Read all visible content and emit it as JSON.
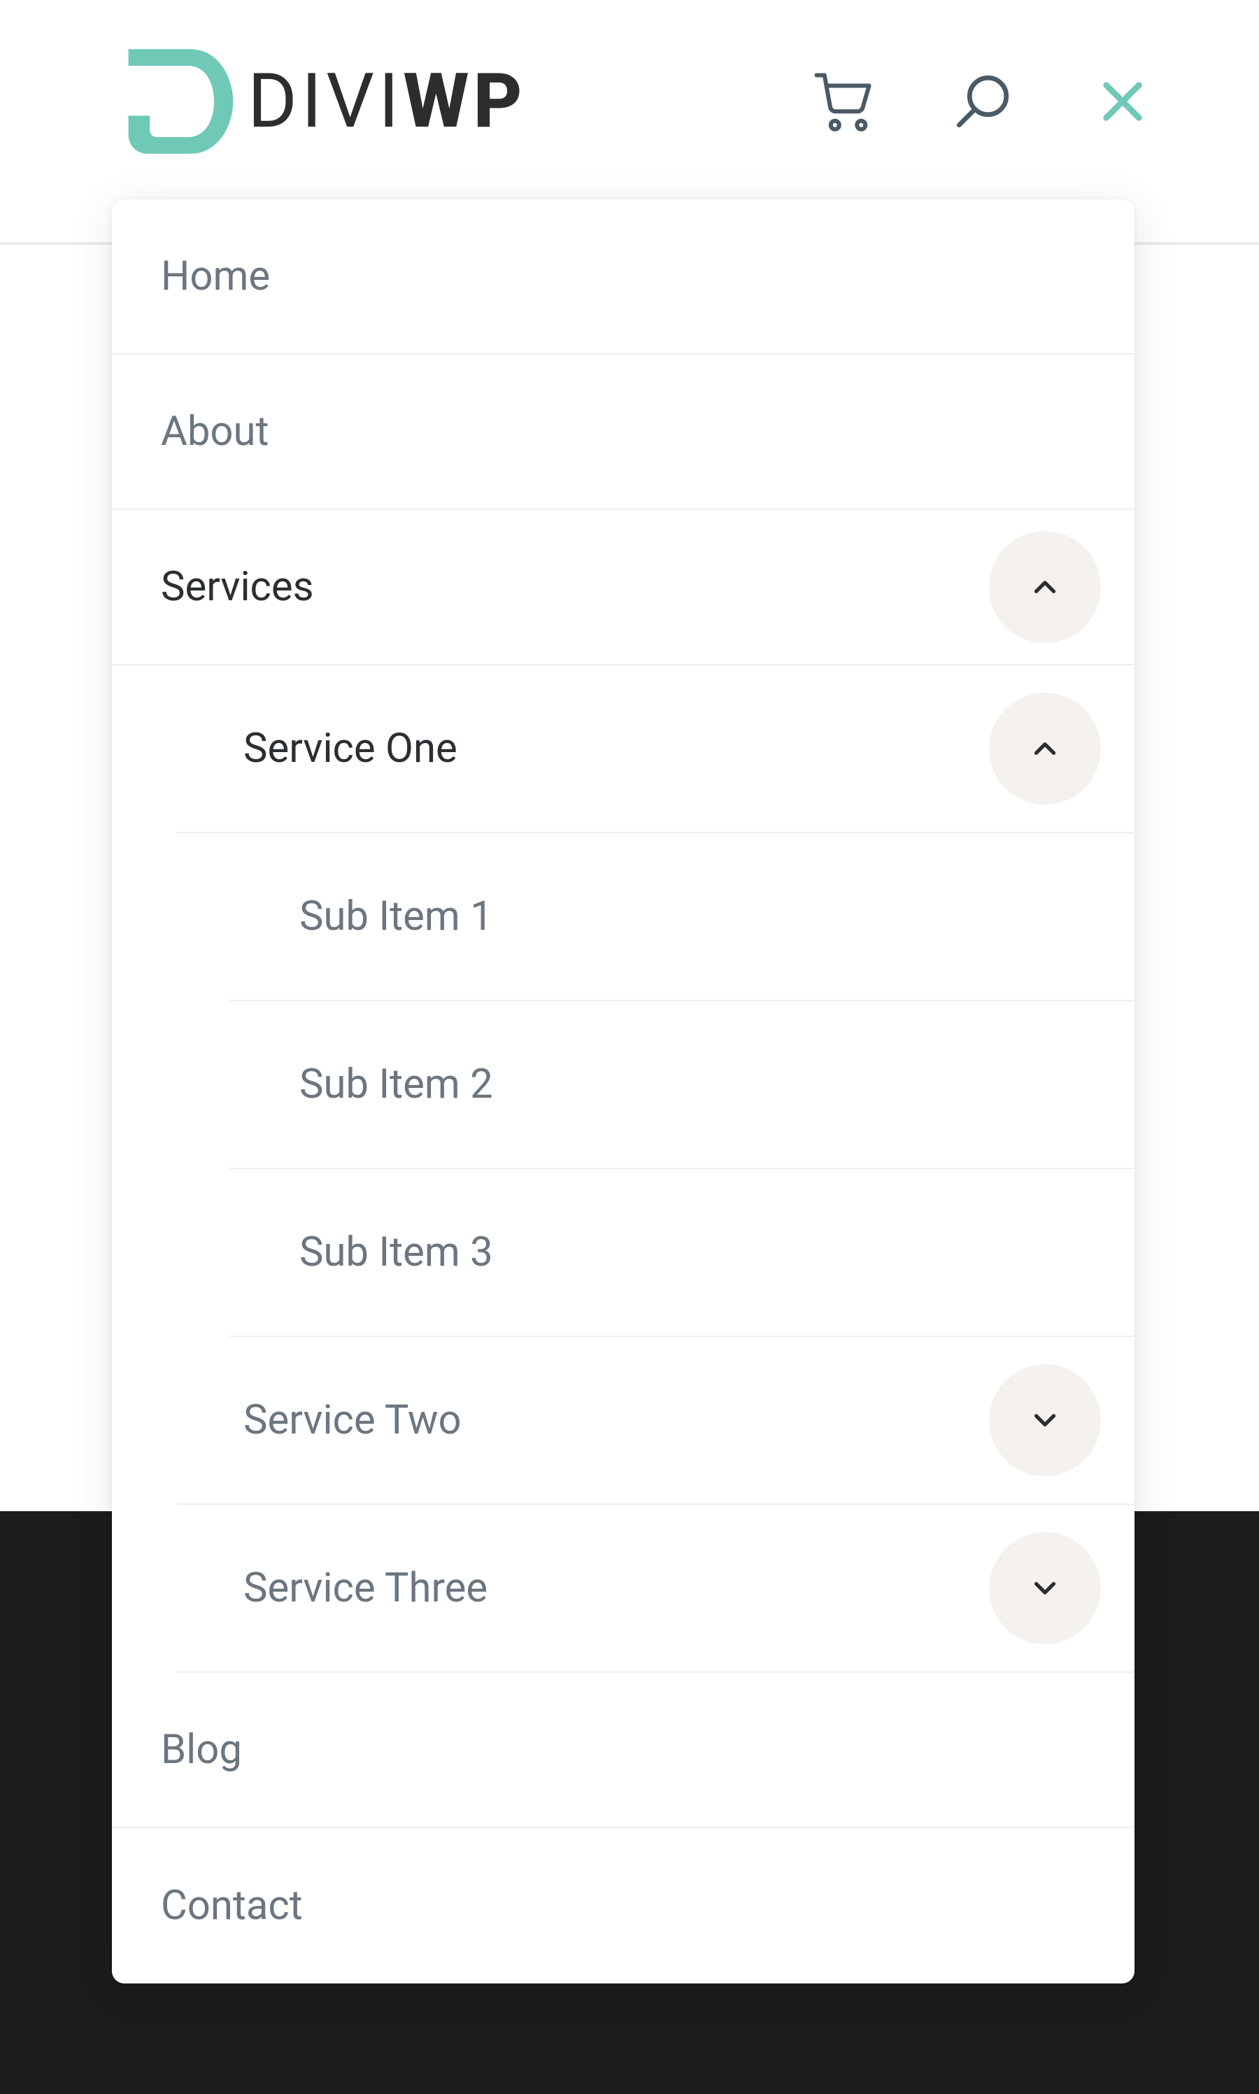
{
  "brand": {
    "text_plain": "DIVI",
    "text_bold": "WP",
    "accent": "#6fc9b6"
  },
  "header_icons": {
    "cart": "cart-icon",
    "search": "search-icon",
    "close": "close-icon"
  },
  "menu": {
    "home": "Home",
    "about": "About",
    "services": {
      "label": "Services",
      "expanded": true,
      "items": {
        "service_one": {
          "label": "Service One",
          "expanded": true,
          "sub": [
            "Sub Item 1",
            "Sub Item 2",
            "Sub Item 3"
          ]
        },
        "service_two": {
          "label": "Service Two",
          "expanded": false
        },
        "service_three": {
          "label": "Service Three",
          "expanded": false
        }
      }
    },
    "blog": "Blog",
    "contact": "Contact"
  },
  "colors": {
    "accent": "#6fc9b6",
    "text_muted": "#6b7680",
    "text_strong": "#2b2f33",
    "toggle_bg": "#f4f1ee",
    "footer": "#1b1c1d"
  }
}
